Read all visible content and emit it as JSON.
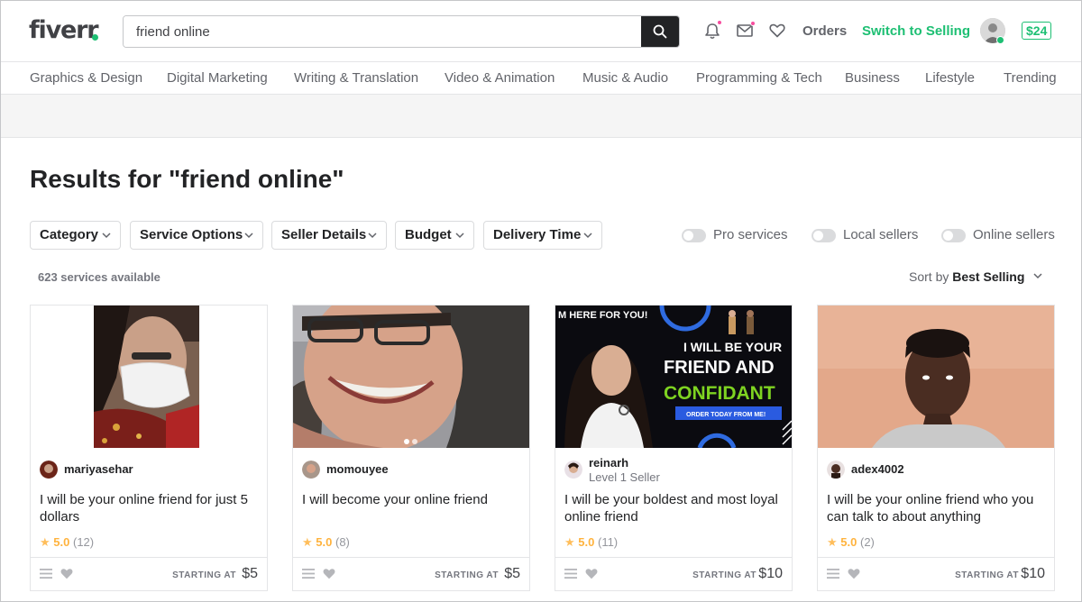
{
  "header": {
    "logo": "fiverr",
    "search_value": "friend online",
    "orders_label": "Orders",
    "switch_label": "Switch to Selling",
    "balance": "$24"
  },
  "categories": [
    "Graphics & Design",
    "Digital Marketing",
    "Writing & Translation",
    "Video & Animation",
    "Music & Audio",
    "Programming & Tech",
    "Business",
    "Lifestyle",
    "Trending"
  ],
  "results_title": "Results for \"friend online\"",
  "filters": [
    "Category",
    "Service Options",
    "Seller Details",
    "Budget",
    "Delivery Time"
  ],
  "toggles": [
    "Pro services",
    "Local sellers",
    "Online sellers"
  ],
  "services_count": "623 services available",
  "sort": {
    "label": "Sort by",
    "value": "Best Selling"
  },
  "gigs": [
    {
      "seller": "mariyasehar",
      "level": "",
      "title": "I will be your online friend for just 5 dollars",
      "rating": "5.0",
      "reviews": "(12)",
      "starting": "STARTING AT",
      "price": "$5"
    },
    {
      "seller": "momouyee",
      "level": "",
      "title": "I will become your online friend",
      "rating": "5.0",
      "reviews": "(8)",
      "starting": "STARTING AT",
      "price": "$5"
    },
    {
      "seller": "reinarh",
      "level": "Level 1 Seller",
      "title": "I will be your boldest and most loyal online friend",
      "rating": "5.0",
      "reviews": "(11)",
      "starting": "STARTING AT",
      "price": "$10"
    },
    {
      "seller": "adex4002",
      "level": "",
      "title": "I will be your online friend who you can talk to about anything",
      "rating": "5.0",
      "reviews": "(2)",
      "starting": "STARTING AT",
      "price": "$10"
    }
  ],
  "gig3_thumb_text": {
    "line1": "M HERE FOR YOU!",
    "line2": "I WILL BE YOUR",
    "line3": "FRIEND AND",
    "line4": "CONFIDANT",
    "cta": "ORDER TODAY FROM ME!"
  },
  "colors": {
    "brand": "#1dbf73",
    "text": "#404145",
    "rating": "#ffbe5b"
  }
}
